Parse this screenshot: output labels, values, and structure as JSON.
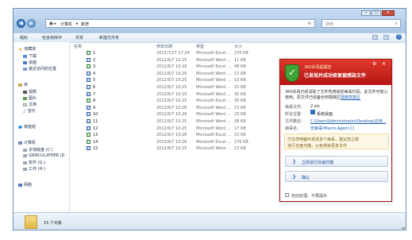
{
  "window": {
    "address_segments": [
      "计算机",
      "新增"
    ],
    "search_placeholder": "搜索"
  },
  "toolbar": {
    "organize": "组织",
    "include_in_library": "包含到库中",
    "share": "共享",
    "new_folder": "新建文件夹"
  },
  "nav": {
    "favorites": "收藏夹",
    "downloads": "下载",
    "desktop": "桌面",
    "recent": "最近访问的位置",
    "libraries": "库",
    "videos": "视频",
    "pictures": "图片",
    "documents": "文档",
    "music": "音乐",
    "homegroup": "家庭组",
    "computer": "计算机",
    "local_disk": "本地磁盘 (C:)",
    "grmcul": "GRMCULXFRER (D",
    "software": "软件 (G:)",
    "work": "工作 (H:)",
    "network": "网络"
  },
  "columns": {
    "name": "名称",
    "date": "修改日期",
    "type": "类型",
    "size": "大小"
  },
  "files": [
    {
      "name": "1",
      "date": "2012/7/27 17:24",
      "type": "Microsoft Excel ...",
      "size": "270 KB",
      "kind": "excel"
    },
    {
      "name": "2",
      "date": "2012/9/7 10:25",
      "type": "Microsoft Word ...",
      "size": "11 KB",
      "kind": "word"
    },
    {
      "name": "3",
      "date": "2012/9/7 10:26",
      "type": "Microsoft Excel ...",
      "size": "48 KB",
      "kind": "excel"
    },
    {
      "name": "4",
      "date": "2012/9/7 10:26",
      "type": "Microsoft Word ...",
      "size": "13 KB",
      "kind": "word"
    },
    {
      "name": "5",
      "date": "2012/9/7 10:25",
      "type": "Microsoft Word ...",
      "size": "10 KB",
      "kind": "word"
    },
    {
      "name": "6",
      "date": "2012/9/7 10:25",
      "type": "Microsoft Word ...",
      "size": "23 KB",
      "kind": "word"
    },
    {
      "name": "7",
      "date": "2012/9/7 10:25",
      "type": "Microsoft Word ...",
      "size": "30 KB",
      "kind": "word"
    },
    {
      "name": "8",
      "date": "2012/9/7 10:25",
      "type": "Microsoft Excel ...",
      "size": "35 KB",
      "kind": "excel"
    },
    {
      "name": "9",
      "date": "2012/9/7 10:26",
      "type": "Microsoft Word ...",
      "size": "23 KB",
      "kind": "word"
    },
    {
      "name": "10",
      "date": "2012/9/7 10:26",
      "type": "Microsoft Word ...",
      "size": "23 KB",
      "kind": "word"
    },
    {
      "name": "11",
      "date": "2012/9/7 10:25",
      "type": "Microsoft Word ...",
      "size": "38 KB",
      "kind": "word"
    },
    {
      "name": "12",
      "date": "2012/9/7 10:25",
      "type": "Microsoft Word ...",
      "size": "17 KB",
      "kind": "word"
    },
    {
      "name": "13",
      "date": "2012/9/7 10:26",
      "type": "Microsoft Excel ...",
      "size": "23 KB",
      "kind": "excel"
    },
    {
      "name": "14",
      "date": "2012/9/7 10:26",
      "type": "Microsoft Excel ...",
      "size": "276 KB",
      "kind": "excel"
    },
    {
      "name": "15",
      "date": "2012/9/7 10:25",
      "type": "Microsoft Word ...",
      "size": "23 KB",
      "kind": "word"
    }
  ],
  "status": {
    "count": "15 个对象"
  },
  "popup": {
    "brand": "360杀毒提醒您",
    "title": "已发现并成功修复被感染文件",
    "desc_line1": "360杀毒已经清除了文件所感染的病毒代码，此文件可放心",
    "desc_line2": "使用。原文件已经备份到隔离区",
    "quarantine_link": "隔离恢复区",
    "label_file": "病毒文件：",
    "value_file": "2.xls",
    "label_location": "所在位置：",
    "value_location": "系统桌面",
    "label_path": "文件路径：",
    "value_path": "C:\\Users\\Administrator\\Desktop\\应用...",
    "label_virus": "病毒名：",
    "value_virus": "宏病毒(Macro.Agent.C)",
    "note_line1": "已在您电脑中发现多个病毒，建议您立即",
    "note_line2": "进行全盘扫描，以免感染更多文件",
    "btn_scan": "立即进行快速扫描",
    "btn_ok": "确认",
    "auto_label": "自动处理，不再提示"
  },
  "colors": {
    "popup_red": "#c41e1e",
    "shield_green": "#3fa335",
    "window_blue": "#a9c6e6"
  }
}
